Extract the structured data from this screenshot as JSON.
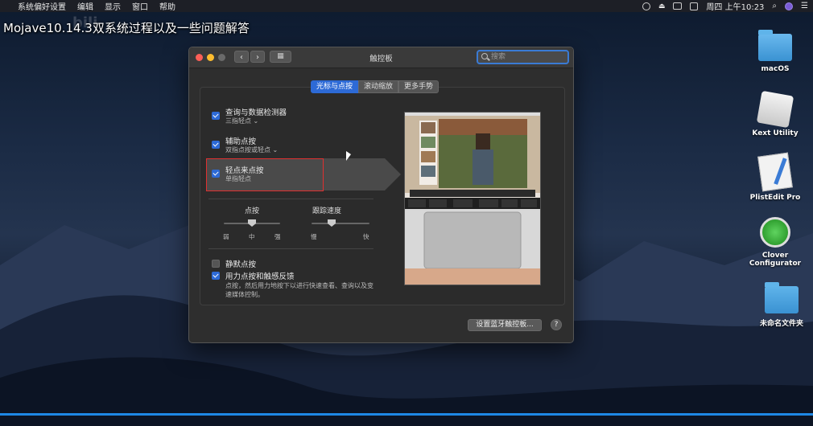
{
  "menubar": {
    "items": [
      "系统偏好设置",
      "编辑",
      "显示",
      "窗口",
      "帮助"
    ],
    "clock": "周四 上午10:23"
  },
  "overlay_title": "Mojave10.14.3双系统过程以及一些问题解答",
  "desktop_icons": [
    {
      "label": "macOS"
    },
    {
      "label": "Kext Utility"
    },
    {
      "label": "PlistEdit Pro"
    },
    {
      "label": "Clover Configurator"
    },
    {
      "label": "未命名文件夹"
    }
  ],
  "window": {
    "title": "触控板",
    "search_placeholder": "搜索",
    "tabs": [
      "光标与点按",
      "滚动缩放",
      "更多手势"
    ],
    "options": [
      {
        "title": "查询与数据检测器",
        "sub": "三指轻点",
        "checked": true
      },
      {
        "title": "辅助点按",
        "sub": "双指点按或轻点",
        "checked": true
      },
      {
        "title": "轻点来点按",
        "sub": "单指轻点",
        "checked": true
      }
    ],
    "click_slider": {
      "label": "点按",
      "ticks": [
        "弱",
        "中",
        "强"
      ],
      "value": 0.5
    },
    "speed_slider": {
      "label": "跟踪速度",
      "ticks": [
        "慢",
        "快"
      ],
      "value": 0.35
    },
    "silent_click": {
      "label": "静默点按",
      "checked": false
    },
    "force_click": {
      "label": "用力点按和触感反馈",
      "checked": true,
      "desc_line1": "点按，然后用力地按下以进行快速查看、查询以及变",
      "desc_line2": "速媒体控制。"
    },
    "setup_button": "设置蓝牙触控板...",
    "help_button": "?"
  },
  "colors": {
    "accent": "#2d6ad6",
    "close": "#fc5f57",
    "minimize": "#fdbc2e",
    "highlight_box": "#e03030"
  }
}
